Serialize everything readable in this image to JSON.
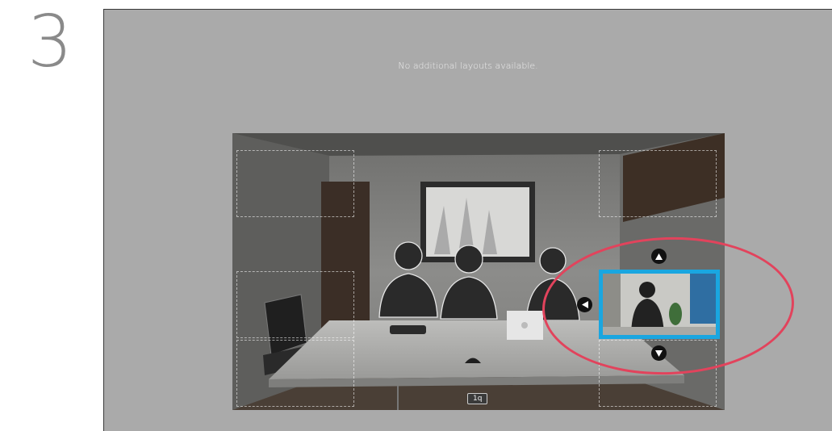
{
  "step": {
    "number": "3"
  },
  "screen": {
    "notice": "No additional layouts available."
  },
  "video": {
    "seat_label": "1q"
  },
  "pip": {
    "move_up_icon": "triangle-up",
    "move_left_icon": "triangle-left",
    "move_down_icon": "triangle-down"
  },
  "colors": {
    "pip_border": "#1aa6e0",
    "highlight": "#e2435c",
    "screen_bg": "#aaaaaa"
  }
}
